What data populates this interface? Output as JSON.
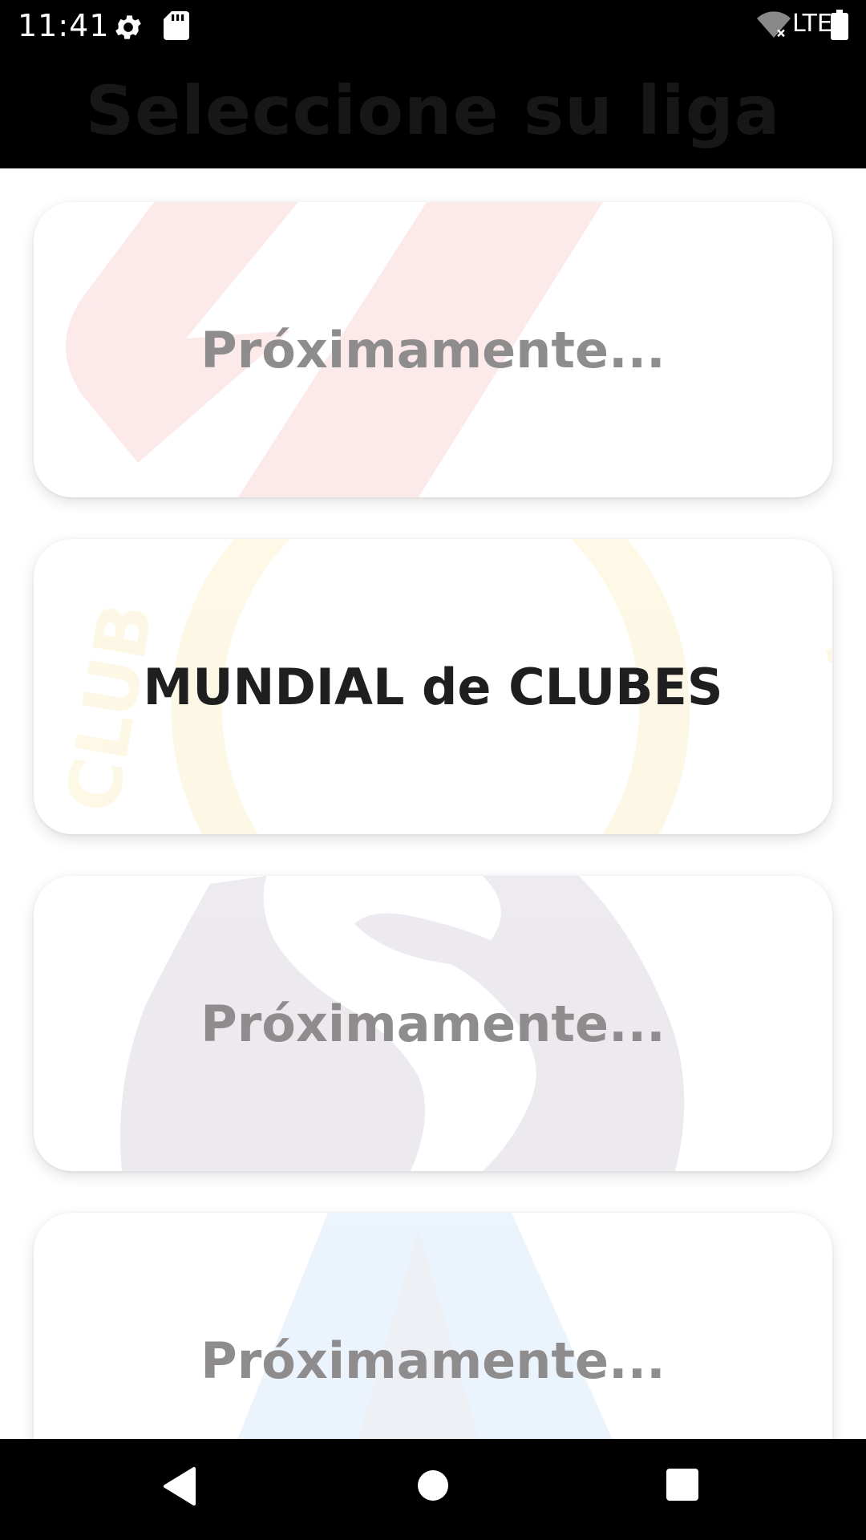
{
  "status_bar": {
    "time": "11:41",
    "network_label": "LTE",
    "icons": [
      "gear-icon",
      "sd-card-icon",
      "wifi-off-icon",
      "battery-icon"
    ]
  },
  "header": {
    "title": "Seleccione su liga"
  },
  "leagues": [
    {
      "label": "Próximamente...",
      "enabled": false,
      "logo": "red-stripes-logo",
      "accent": "#e8262f"
    },
    {
      "label": "MUNDIAL de CLUBES",
      "enabled": true,
      "logo": "club-world-cup-logo",
      "accent": "#f2c23b"
    },
    {
      "label": "Próximamente...",
      "enabled": false,
      "logo": "lion-logo",
      "accent": "#3d195b"
    },
    {
      "label": "Próximamente...",
      "enabled": false,
      "logo": "triangle-logo",
      "accent": "#2f8be0"
    }
  ],
  "nav_bar": {
    "icons": [
      "back-icon",
      "home-icon",
      "recents-icon"
    ]
  }
}
